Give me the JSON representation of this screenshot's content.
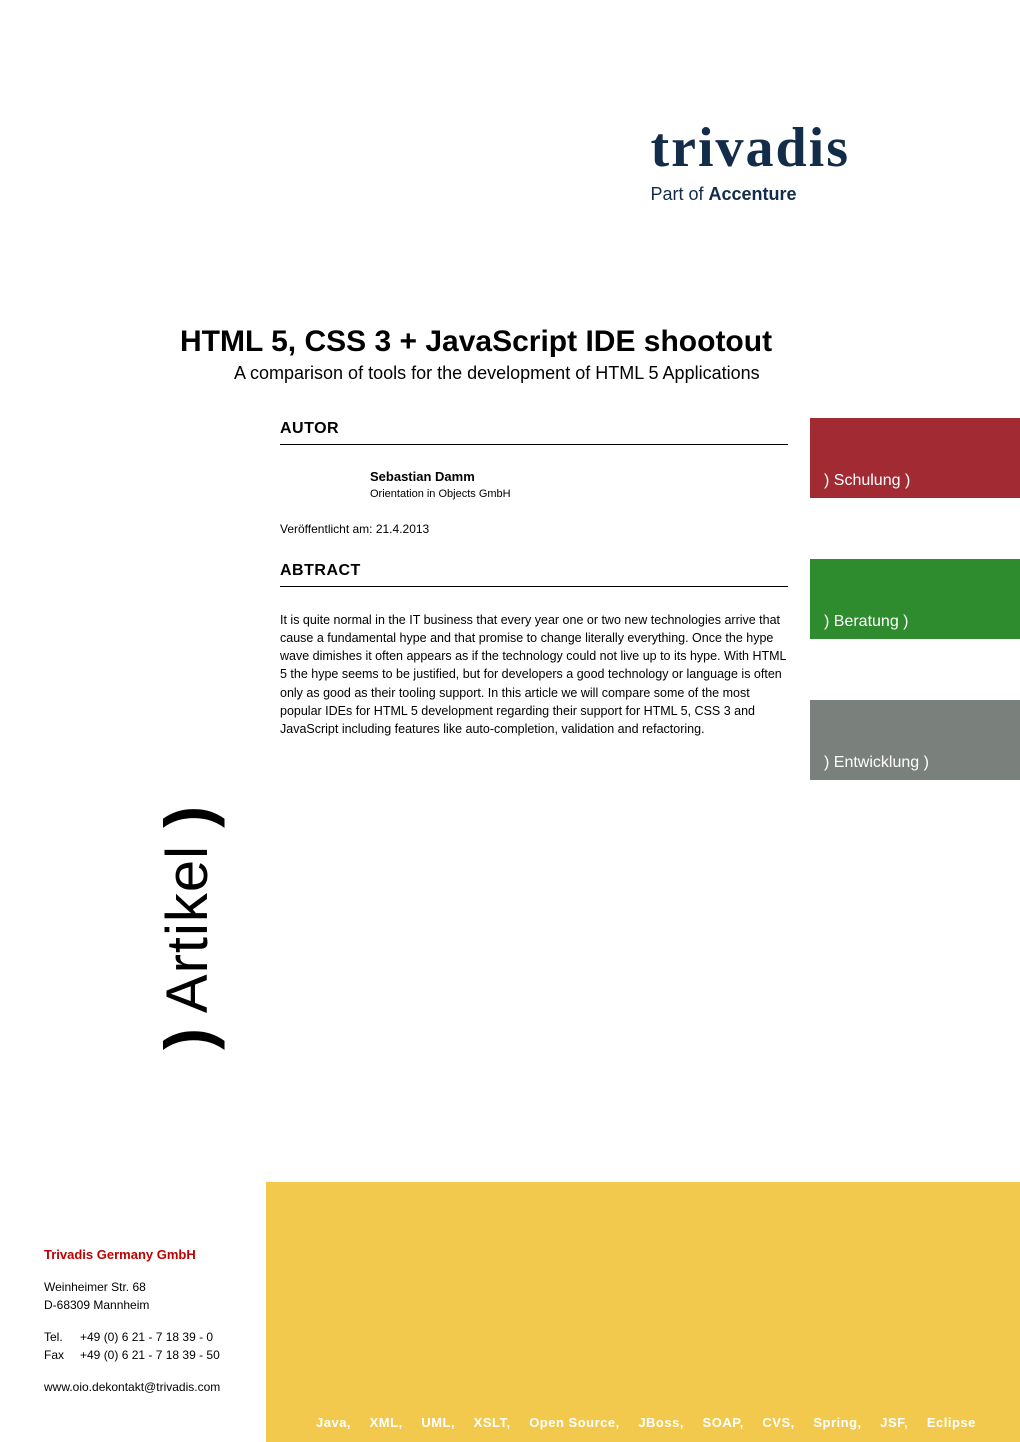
{
  "logo": {
    "wordmark": "trivadis",
    "tagline_prefix": "Part of ",
    "tagline_brand": "Accenture"
  },
  "title": {
    "main": "HTML 5, CSS 3 + JavaScript IDE shootout",
    "subtitle": "A comparison of tools for the development of HTML 5 Applications"
  },
  "sections": {
    "author_heading": "AUTOR",
    "abstract_heading": "ABTRACT"
  },
  "author": {
    "name": "Sebastian Damm",
    "org": "Orientation in Objects GmbH"
  },
  "publication": {
    "label": "Veröffentlicht am: 21.4.2013"
  },
  "abstract": {
    "text": "It is quite normal in the IT business that every year one or two new technologies arrive that cause a fundamental hype and that promise to change literally everything. Once the hype wave dimishes it often appears as if the technology could not live up to its hype. With HTML 5 the hype seems to be justified, but for developers a good technology or language is often only as good as their tooling support. In this article we will compare some of the most popular IDEs for HTML 5 development regarding their support for HTML 5, CSS 3 and JavaScript including features like auto-completion, validation and refactoring."
  },
  "pills": {
    "schulung": ") Schulung )",
    "beratung": ") Beratung )",
    "entwicklung": ") Entwicklung )"
  },
  "vertical_label": {
    "open": ")",
    "text": " Artikel ",
    "close": ")"
  },
  "footer": {
    "company": "Trivadis Germany GmbH",
    "address_line1": "Weinheimer Str. 68",
    "address_line2": "D-68309 Mannheim",
    "tel_label": "Tel.",
    "tel_value": "+49 (0) 6 21 - 7 18 39 - 0",
    "fax_label": "Fax",
    "fax_value": "+49 (0) 6 21 - 7 18 39 - 50",
    "web_email": "www.oio.dekontakt@trivadis.com",
    "keywords": [
      "Java",
      "XML",
      "UML",
      "XSLT",
      "Open Source",
      "JBoss",
      "SOAP",
      "CVS",
      "Spring",
      "JSF",
      "Eclipse"
    ]
  }
}
